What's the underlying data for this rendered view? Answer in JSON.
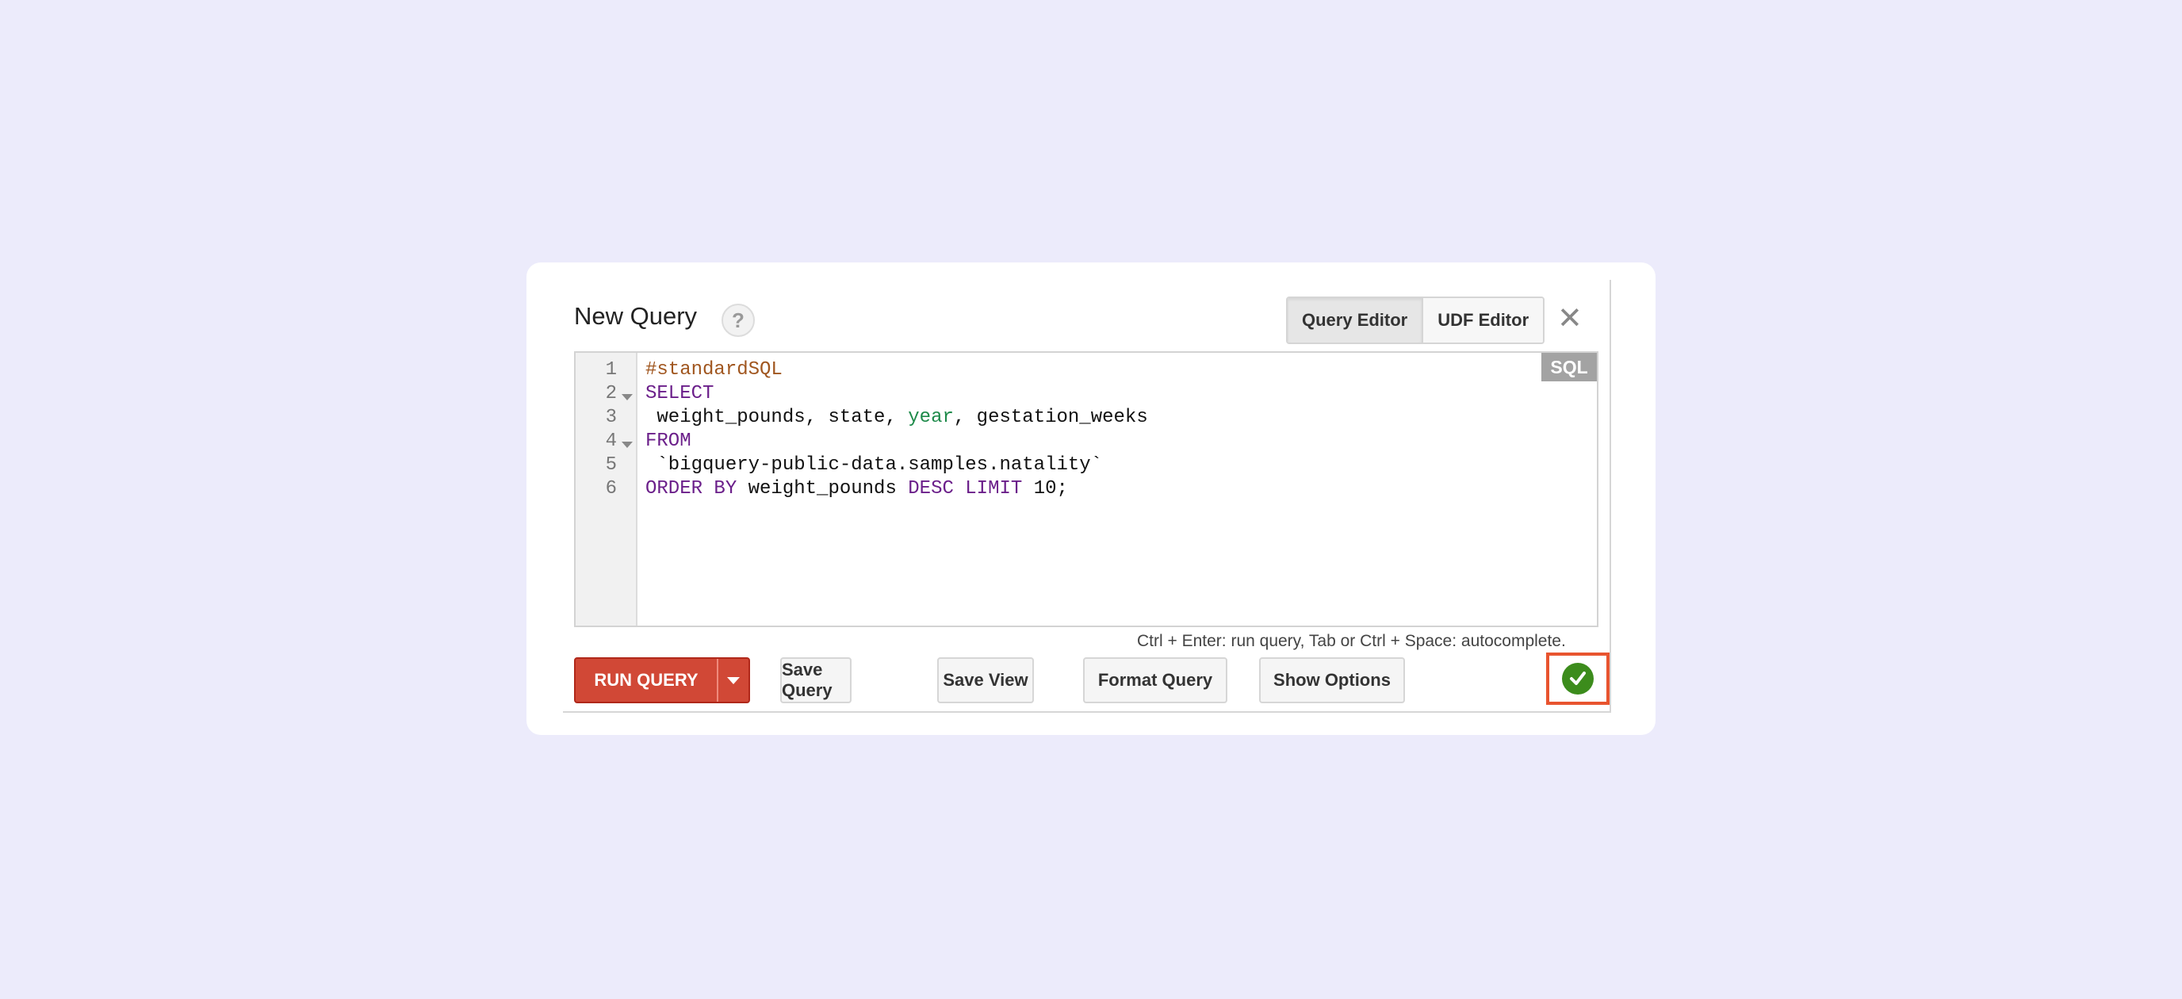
{
  "dialog": {
    "title": "New Query",
    "help_label": "?",
    "tabs": [
      {
        "label": "Query Editor",
        "active": true
      },
      {
        "label": "UDF Editor",
        "active": false
      }
    ],
    "close_label": "✕"
  },
  "editor": {
    "language_badge": "SQL",
    "line_numbers": [
      "1",
      "2",
      "3",
      "4",
      "5",
      "6"
    ],
    "lines": [
      {
        "tokens": [
          {
            "text": "#standardSQL",
            "type": "comment"
          }
        ]
      },
      {
        "tokens": [
          {
            "text": "SELECT",
            "type": "keyword"
          }
        ]
      },
      {
        "tokens": [
          {
            "text": " weight_pounds, state, ",
            "type": "plain"
          },
          {
            "text": "year",
            "type": "function"
          },
          {
            "text": ", gestation_weeks",
            "type": "plain"
          }
        ]
      },
      {
        "tokens": [
          {
            "text": "FROM",
            "type": "keyword"
          }
        ]
      },
      {
        "tokens": [
          {
            "text": " `bigquery-public-data.samples.natality`",
            "type": "plain"
          }
        ]
      },
      {
        "tokens": [
          {
            "text": "ORDER BY",
            "type": "keyword"
          },
          {
            "text": " weight_pounds ",
            "type": "plain"
          },
          {
            "text": "DESC LIMIT",
            "type": "keyword"
          },
          {
            "text": " 10;",
            "type": "plain"
          }
        ]
      }
    ]
  },
  "hint": "Ctrl + Enter: run query, Tab or Ctrl + Space: autocomplete.",
  "toolbar": {
    "run_label": "RUN QUERY",
    "save_query_label": "Save Query",
    "save_view_label": "Save View",
    "format_query_label": "Format Query",
    "show_options_label": "Show Options"
  },
  "validator": {
    "status": "valid",
    "icon": "check-circle-icon"
  },
  "colors": {
    "background": "#ecebfb",
    "run_button": "#d14836",
    "keyword": "#6b1f8a",
    "comment": "#a0561f",
    "function": "#1e8a4a",
    "valid_icon": "#3c8c1c",
    "highlight_box": "#e8542f"
  }
}
